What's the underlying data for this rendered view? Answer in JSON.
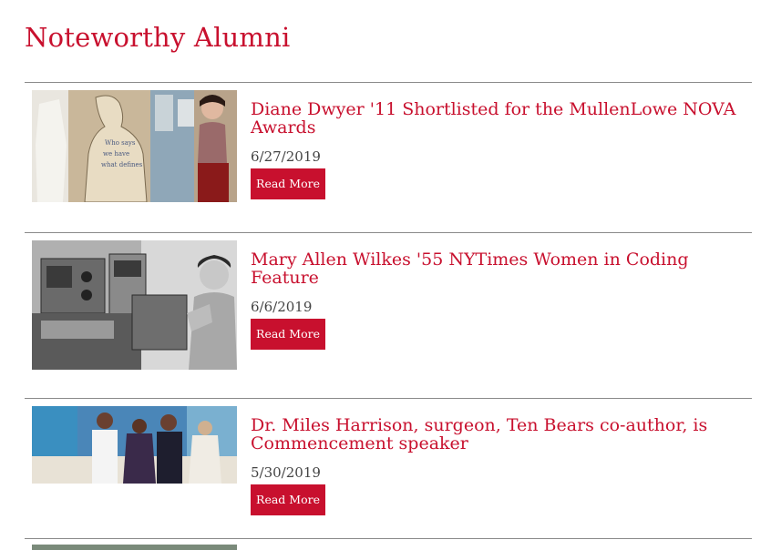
{
  "page": {
    "title": "Noteworthy Alumni"
  },
  "theme": {
    "accent": "#c8102e",
    "rule": "#8a8a8a",
    "date_text": "#444444"
  },
  "articles": [
    {
      "title": "Diane Dwyer '11 Shortlisted for the MullenLowe NOVA Awards",
      "date": "6/27/2019",
      "button": "Read More",
      "image": "photo-artist-with-cutout-figure"
    },
    {
      "title": "Mary Allen Wilkes '55 NYTimes Women in Coding Feature",
      "date": "6/6/2019",
      "button": "Read More",
      "image": "photo-woman-at-vintage-computer"
    },
    {
      "title": "Dr. Miles Harrison, surgeon, Ten Bears co-author, is Commencement speaker",
      "date": "5/30/2019",
      "button": "Read More",
      "image": "photo-group-of-four-people"
    }
  ]
}
